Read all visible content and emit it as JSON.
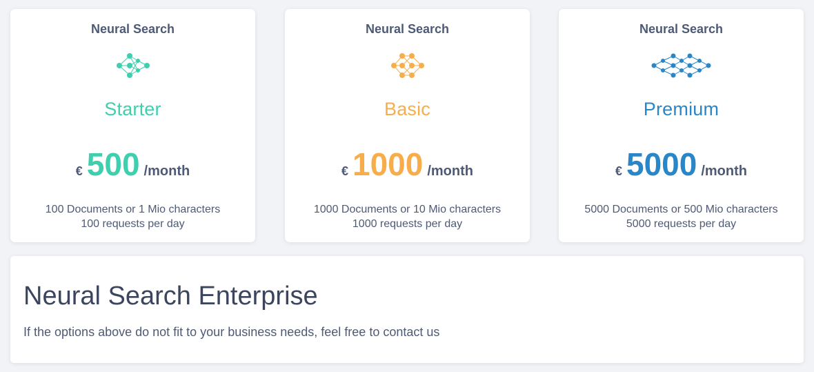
{
  "plans": [
    {
      "title": "Neural Search",
      "icon": "neural-network-icon",
      "tier": "Starter",
      "currency": "€",
      "price": "500",
      "period": "/month",
      "line1": "100 Documents or 1 Mio characters",
      "line2": "100 requests per day",
      "color": "#3ecfae"
    },
    {
      "title": "Neural Search",
      "icon": "neural-network-icon",
      "tier": "Basic",
      "currency": "€",
      "price": "1000",
      "period": "/month",
      "line1": "1000 Documents or 10 Mio characters",
      "line2": "1000 requests per day",
      "color": "#f7ae4a"
    },
    {
      "title": "Neural Search",
      "icon": "neural-network-icon",
      "tier": "Premium",
      "currency": "€",
      "price": "5000",
      "period": "/month",
      "line1": "5000 Documents or 500 Mio characters",
      "line2": "5000 requests per day",
      "color": "#2a86c7"
    }
  ],
  "enterprise": {
    "title": "Neural Search Enterprise",
    "text": "If the options above do not fit to your business needs, feel free to contact us"
  }
}
